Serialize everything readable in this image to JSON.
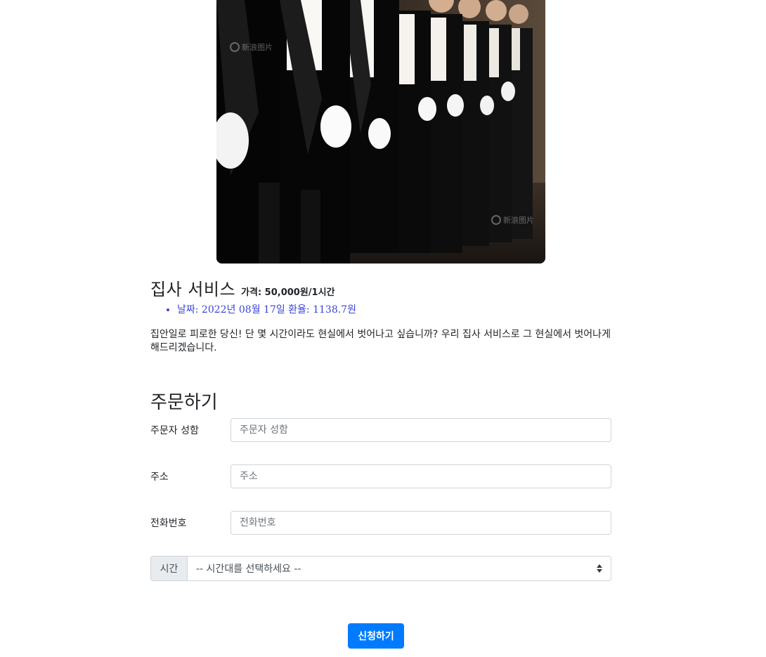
{
  "service": {
    "title": "집사 서비스",
    "price": "가격: 50,000원/1시간",
    "info_items": [
      "날짜: 2022년 08월 17일 환율: 1138.7원"
    ],
    "description": "집안일로 피로한 당신! 단 몇 시간이라도 현실에서 벗어나고 싶습니까? 우리 집사 서비스로 그 현실에서 벗어나게 해드리겠습니다.",
    "image_icon": "butler-photo",
    "image_watermark": "新浪图片"
  },
  "order": {
    "heading": "주문하기",
    "fields": [
      {
        "label": "주문자 성함",
        "placeholder": "주문자 성함",
        "value": ""
      },
      {
        "label": "주소",
        "placeholder": "주소",
        "value": ""
      },
      {
        "label": "전화번호",
        "placeholder": "전화번호",
        "value": ""
      }
    ],
    "time_prepend": "시간",
    "time_selected": "-- 시간대를 선택하세요 --",
    "submit_label": "신청하기"
  },
  "colors": {
    "accent": "#007bff",
    "list_text": "#3a44d6"
  }
}
